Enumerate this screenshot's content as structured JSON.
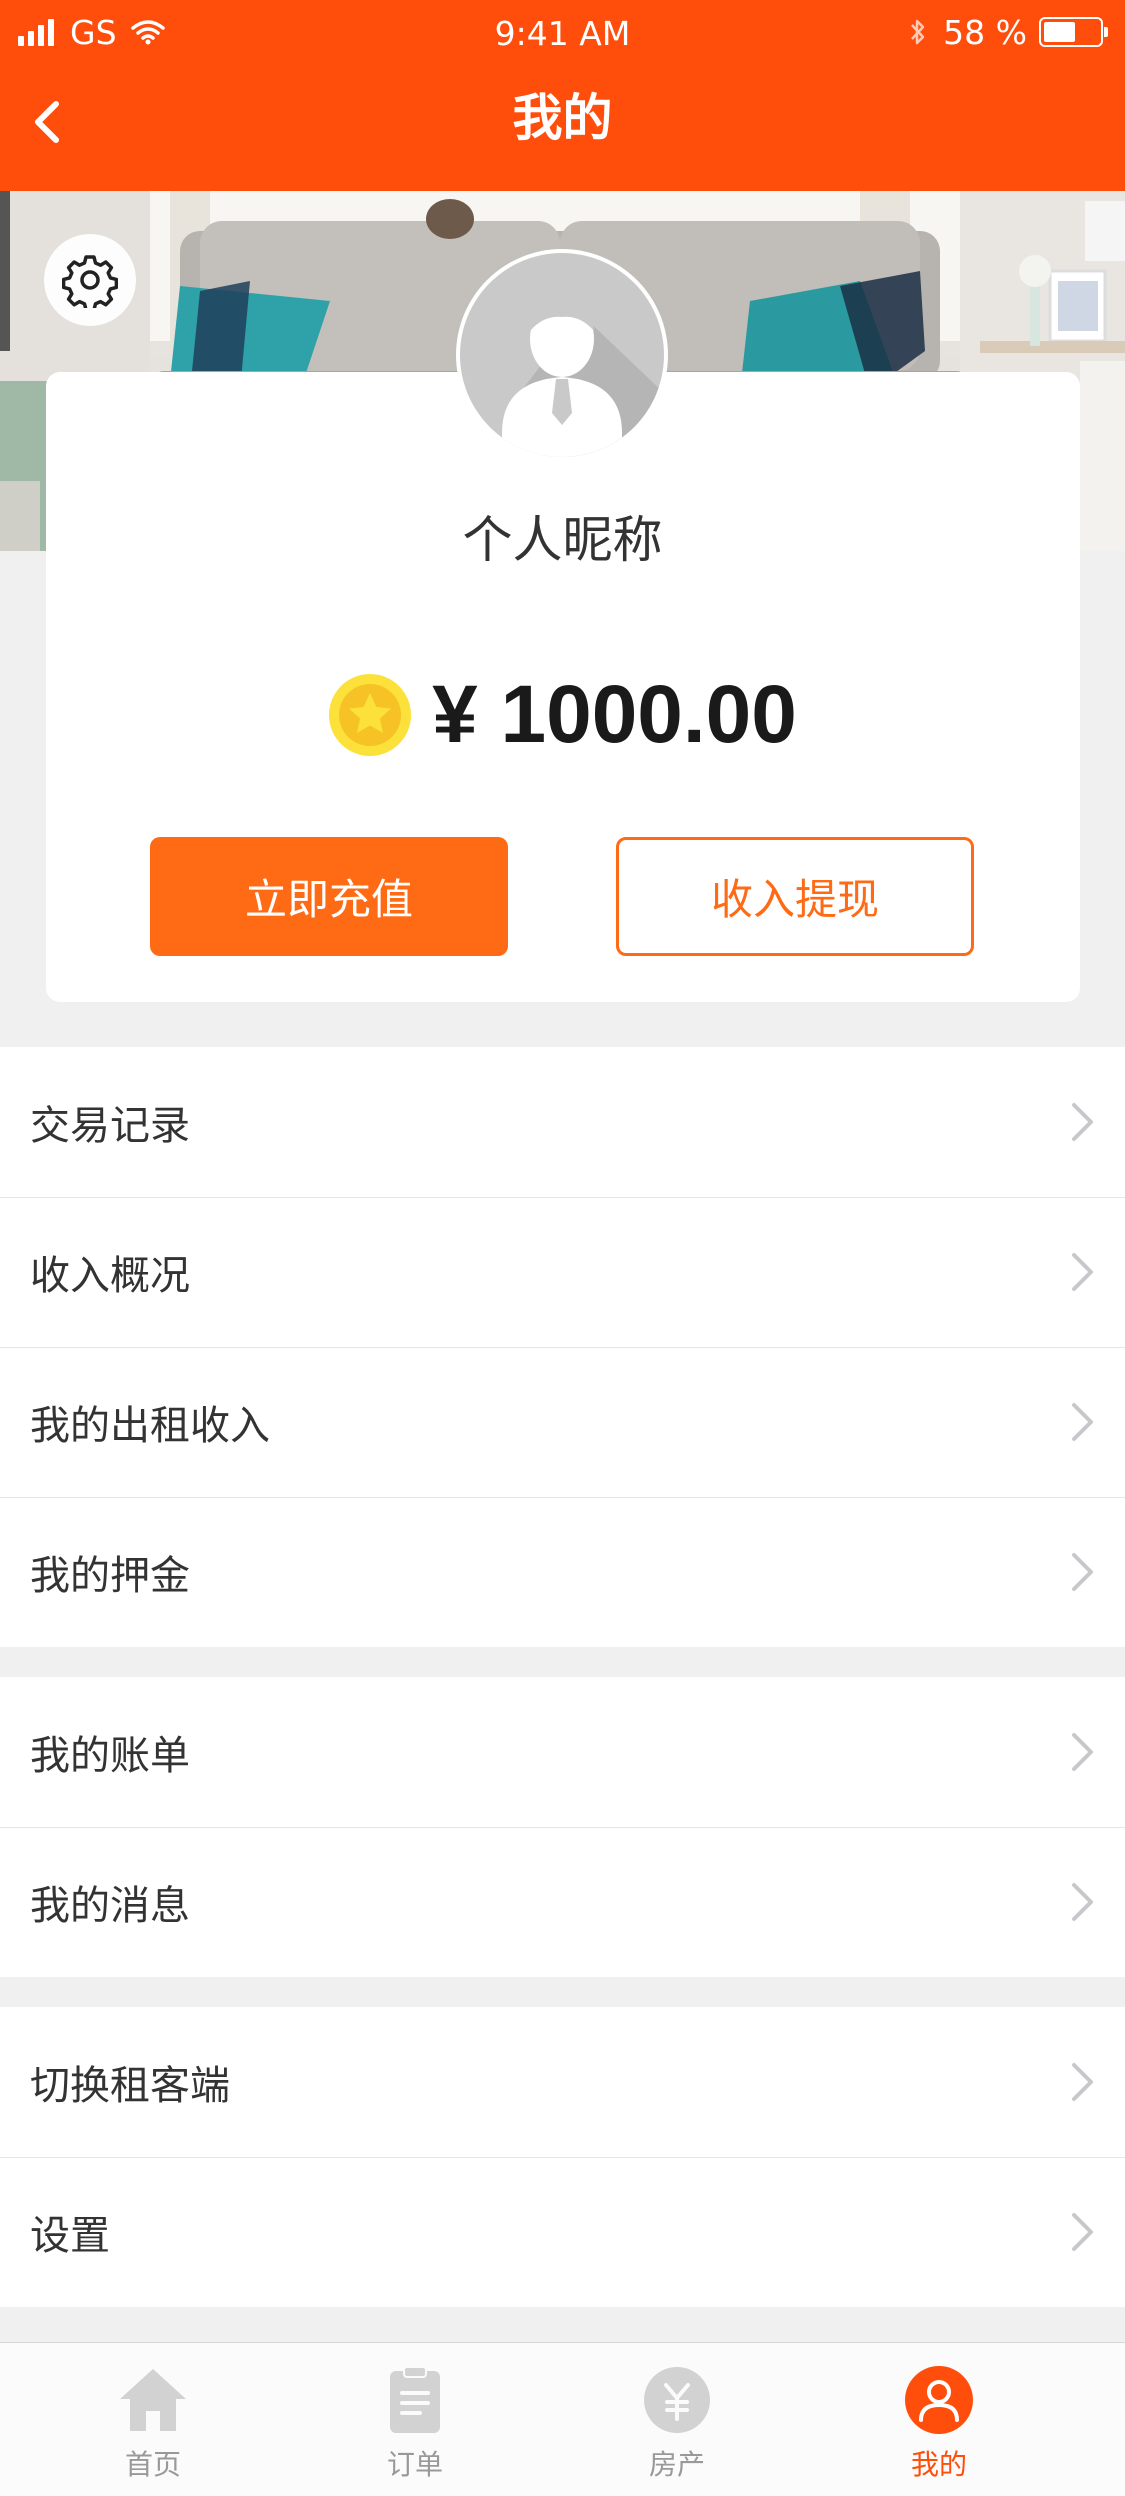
{
  "status_bar": {
    "carrier": "GS",
    "time": "9:41 AM",
    "battery": "58 %",
    "battery_level": 0.58
  },
  "nav": {
    "title": "我的"
  },
  "profile": {
    "nickname": "个人昵称",
    "balance": "¥ 1000.00"
  },
  "actions": {
    "recharge": "立即充值",
    "withdraw": "收入提现"
  },
  "menu": {
    "group1": [
      {
        "label": "交易记录"
      },
      {
        "label": "收入概况"
      },
      {
        "label": "我的出租收入"
      },
      {
        "label": "我的押金"
      }
    ],
    "group2": [
      {
        "label": "我的账单"
      },
      {
        "label": "我的消息"
      }
    ],
    "group3": [
      {
        "label": "切换租客端"
      },
      {
        "label": "设置"
      }
    ]
  },
  "tabbar": {
    "tabs": [
      {
        "label": "首页",
        "icon": "home-icon"
      },
      {
        "label": "订单",
        "icon": "clipboard-icon"
      },
      {
        "label": "房产",
        "icon": "currency-icon"
      },
      {
        "label": "我的",
        "icon": "user-icon",
        "active": true
      }
    ]
  },
  "colors": {
    "brand": "#ff4e0b",
    "accent": "#ff6a14",
    "inactive": "#cccccc"
  }
}
